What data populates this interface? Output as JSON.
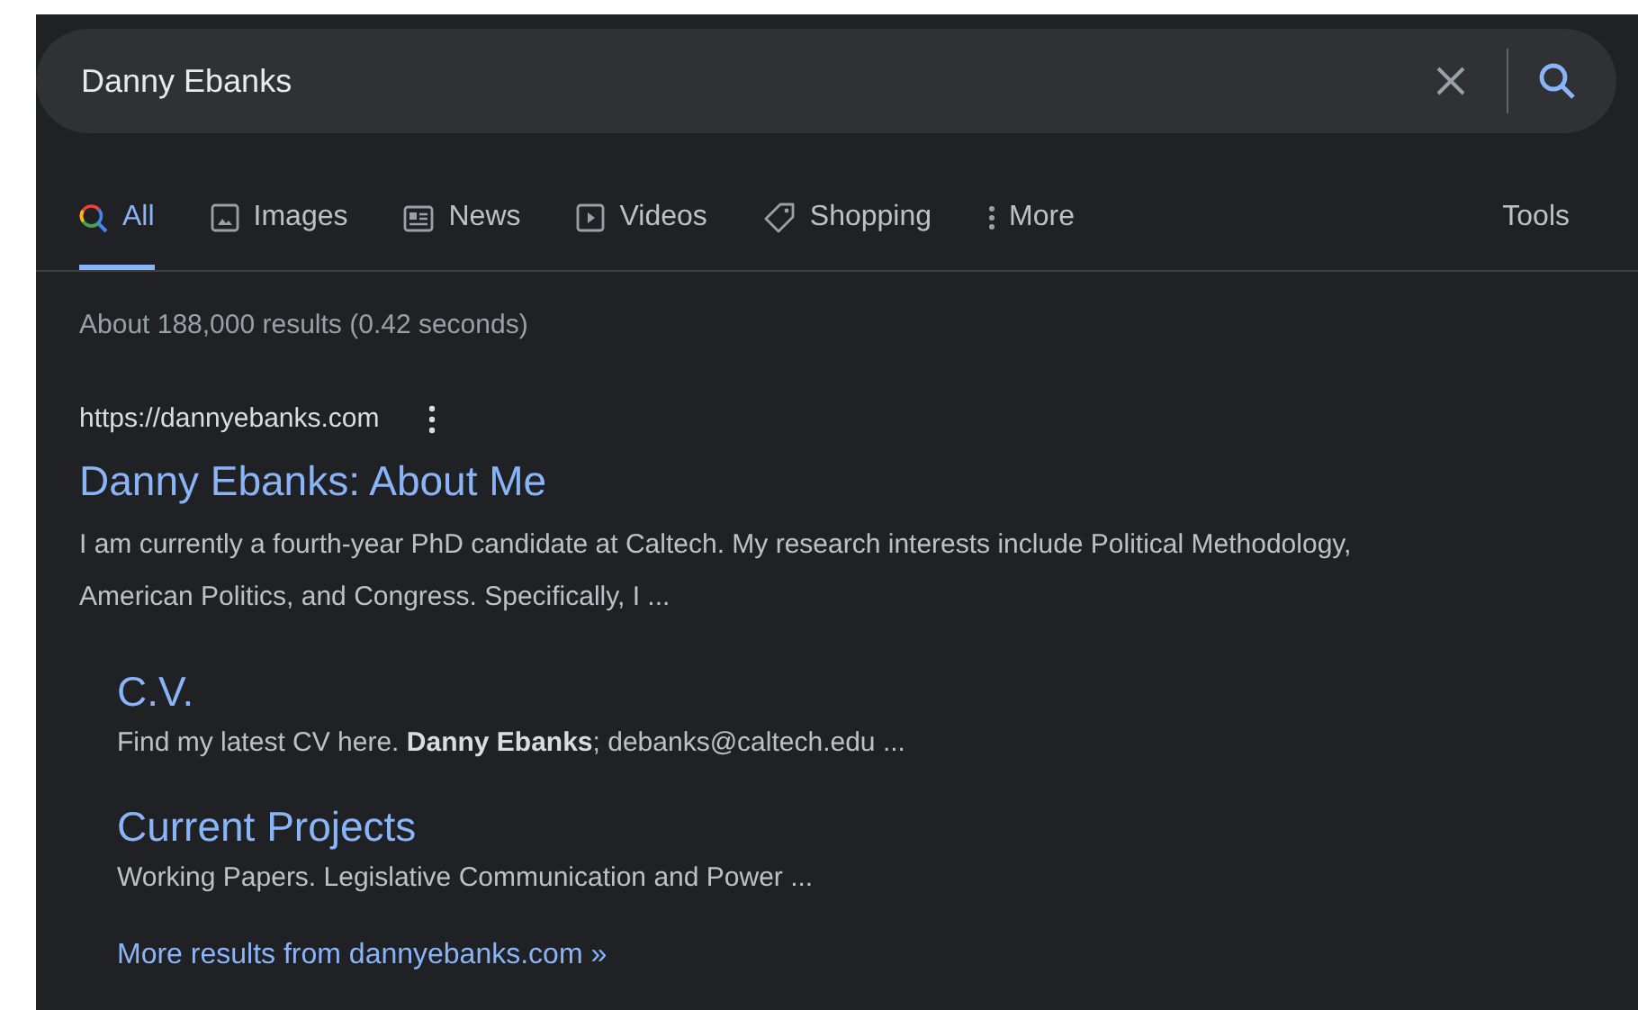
{
  "search": {
    "value": "Danny Ebanks"
  },
  "tabs": [
    {
      "label": "All",
      "kind": "all",
      "selected": true
    },
    {
      "label": "Images",
      "kind": "images",
      "selected": false
    },
    {
      "label": "News",
      "kind": "news",
      "selected": false
    },
    {
      "label": "Videos",
      "kind": "videos",
      "selected": false
    },
    {
      "label": "Shopping",
      "kind": "shopping",
      "selected": false
    },
    {
      "label": "More",
      "kind": "more",
      "selected": false
    }
  ],
  "tools": "Tools",
  "result_stats": "About 188,000 results (0.42 seconds)",
  "result": {
    "url": "https://dannyebanks.com",
    "title": "Danny Ebanks: About Me",
    "snippet": "I am currently a fourth-year PhD candidate at Caltech. My research interests include Political Methodology, American Politics, and Congress. Specifically, I ...",
    "sitelinks": [
      {
        "title": "C.V.",
        "snippet": "Find my latest CV here. **Danny Ebanks**; debanks@caltech.edu ..."
      },
      {
        "title": "Current Projects",
        "snippet": "Working Papers. Legislative Communication and Power ..."
      }
    ],
    "more_link": "More results from dannyebanks.com »"
  }
}
